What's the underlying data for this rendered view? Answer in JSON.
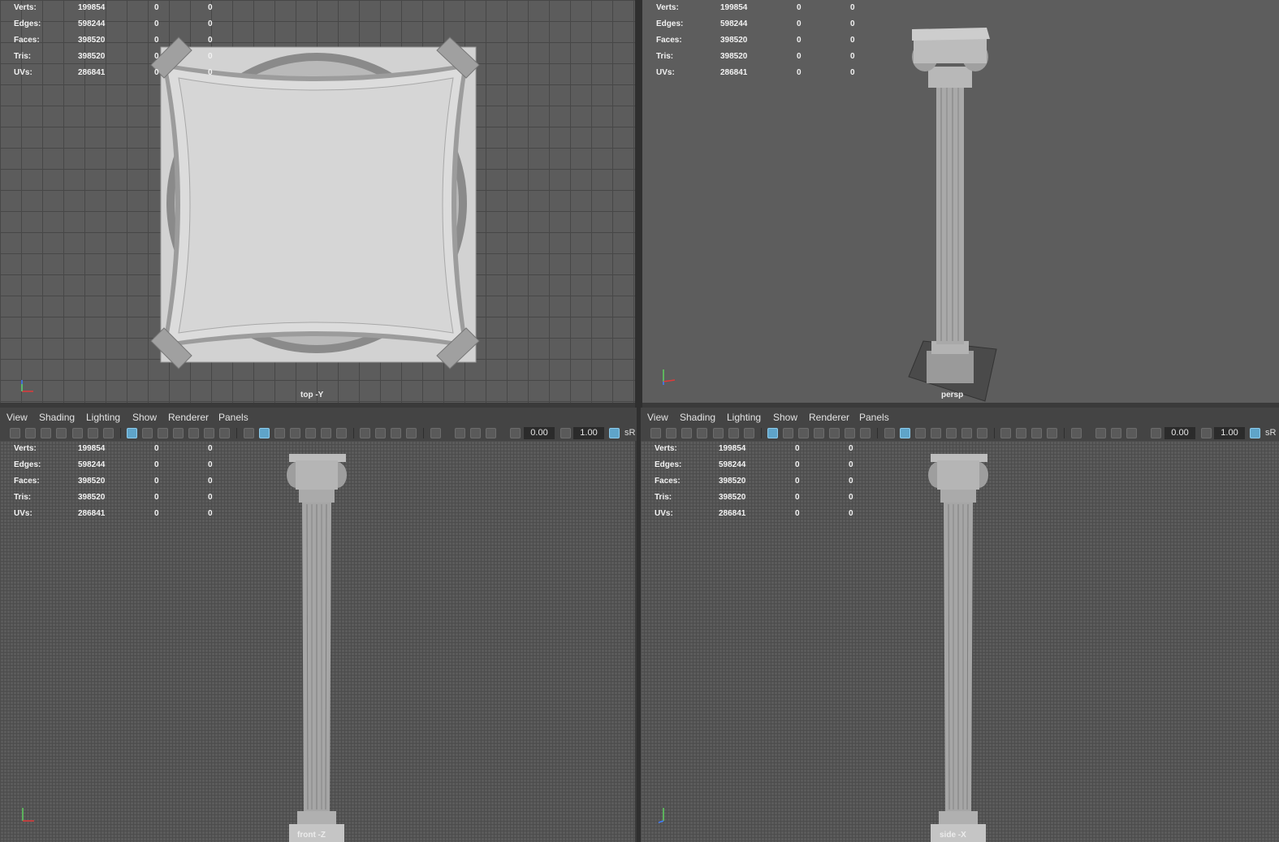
{
  "stats": {
    "rows": [
      {
        "label": "Verts:",
        "v1": "199854",
        "v2": "0",
        "v3": "0"
      },
      {
        "label": "Edges:",
        "v1": "598244",
        "v2": "0",
        "v3": "0"
      },
      {
        "label": "Faces:",
        "v1": "398520",
        "v2": "0",
        "v3": "0"
      },
      {
        "label": "Tris:",
        "v1": "398520",
        "v2": "0",
        "v3": "0"
      },
      {
        "label": "UVs:",
        "v1": "286841",
        "v2": "0",
        "v3": "0"
      }
    ]
  },
  "viewports": {
    "top": {
      "camera": "top -Y"
    },
    "persp": {
      "camera": "persp"
    },
    "front": {
      "camera": "front -Z"
    },
    "side": {
      "camera": "side -X"
    }
  },
  "panel_menu": {
    "view": "View",
    "shading": "Shading",
    "lighting": "Lighting",
    "show": "Show",
    "renderer": "Renderer",
    "panels": "Panels"
  },
  "toolbar": {
    "exposure": "0.00",
    "gamma": "1.00",
    "color_space": "sR"
  },
  "colors": {
    "accent_active": "#5fa4c9",
    "viewport_bg": "#5c5c5c",
    "model_grey": "#c8c8c8"
  }
}
